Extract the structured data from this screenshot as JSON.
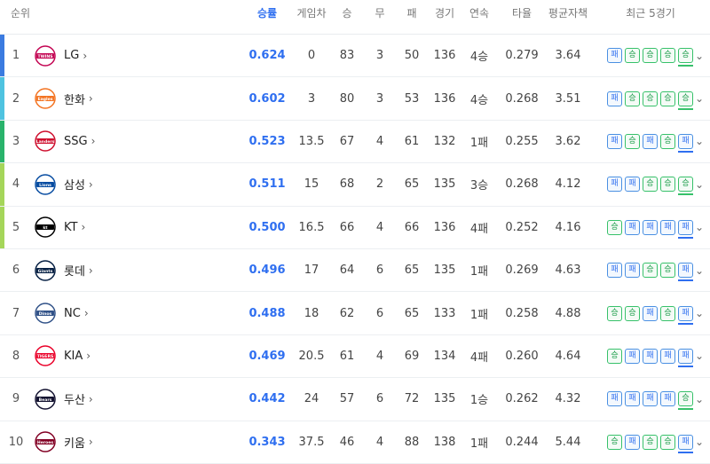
{
  "headers": {
    "rank": "순위",
    "wpct": "승률",
    "gb": "게임차",
    "w": "승",
    "d": "무",
    "l": "패",
    "g": "경기",
    "streak": "연속",
    "avg": "타율",
    "era": "평균자책",
    "recent": "최근 5경기"
  },
  "colors": {
    "accent": "#2f6ff0",
    "win": "#37c16a",
    "loss": "#4a90e2",
    "bar_top2": "#4a90e2",
    "bar_3": "#29b36b",
    "bar_4_5": "#a5d65a"
  },
  "rows": [
    {
      "rank": "1",
      "team": "LG",
      "wpct": "0.624",
      "gb": "0",
      "w": "83",
      "d": "3",
      "l": "50",
      "g": "136",
      "streak": "4승",
      "avg": "0.279",
      "era": "3.64",
      "recent": [
        "패",
        "승",
        "승",
        "승",
        "승"
      ],
      "bar": "#3b7be0",
      "logo_text": "TWINS",
      "logo_color": "#c30452"
    },
    {
      "rank": "2",
      "team": "한화",
      "wpct": "0.602",
      "gb": "3",
      "w": "80",
      "d": "3",
      "l": "53",
      "g": "136",
      "streak": "4승",
      "avg": "0.268",
      "era": "3.51",
      "recent": [
        "패",
        "승",
        "승",
        "승",
        "승"
      ],
      "bar": "#4fc3e0",
      "logo_text": "Eagles",
      "logo_color": "#f37321"
    },
    {
      "rank": "3",
      "team": "SSG",
      "wpct": "0.523",
      "gb": "13.5",
      "w": "67",
      "d": "4",
      "l": "61",
      "g": "132",
      "streak": "1패",
      "avg": "0.255",
      "era": "3.62",
      "recent": [
        "패",
        "승",
        "패",
        "승",
        "패"
      ],
      "bar": "#29b36b",
      "logo_text": "Landers",
      "logo_color": "#ce0e2d"
    },
    {
      "rank": "4",
      "team": "삼성",
      "wpct": "0.511",
      "gb": "15",
      "w": "68",
      "d": "2",
      "l": "65",
      "g": "135",
      "streak": "3승",
      "avg": "0.268",
      "era": "4.12",
      "recent": [
        "패",
        "패",
        "승",
        "승",
        "승"
      ],
      "bar": "#a5d65a",
      "logo_text": "Lions",
      "logo_color": "#074ca1"
    },
    {
      "rank": "5",
      "team": "KT",
      "wpct": "0.500",
      "gb": "16.5",
      "w": "66",
      "d": "4",
      "l": "66",
      "g": "136",
      "streak": "4패",
      "avg": "0.252",
      "era": "4.16",
      "recent": [
        "승",
        "패",
        "패",
        "패",
        "패"
      ],
      "bar": "#a5d65a",
      "logo_text": "kt",
      "logo_color": "#000000"
    },
    {
      "rank": "6",
      "team": "롯데",
      "wpct": "0.496",
      "gb": "17",
      "w": "64",
      "d": "6",
      "l": "65",
      "g": "135",
      "streak": "1패",
      "avg": "0.269",
      "era": "4.63",
      "recent": [
        "패",
        "패",
        "승",
        "승",
        "패"
      ],
      "bar": "",
      "logo_text": "Giants",
      "logo_color": "#041e42"
    },
    {
      "rank": "7",
      "team": "NC",
      "wpct": "0.488",
      "gb": "18",
      "w": "62",
      "d": "6",
      "l": "65",
      "g": "133",
      "streak": "1패",
      "avg": "0.258",
      "era": "4.88",
      "recent": [
        "승",
        "승",
        "패",
        "승",
        "패"
      ],
      "bar": "",
      "logo_text": "Dinos",
      "logo_color": "#315288"
    },
    {
      "rank": "8",
      "team": "KIA",
      "wpct": "0.469",
      "gb": "20.5",
      "w": "61",
      "d": "4",
      "l": "69",
      "g": "134",
      "streak": "4패",
      "avg": "0.260",
      "era": "4.64",
      "recent": [
        "승",
        "패",
        "패",
        "패",
        "패"
      ],
      "bar": "",
      "logo_text": "TIGERS",
      "logo_color": "#ea0029"
    },
    {
      "rank": "9",
      "team": "두산",
      "wpct": "0.442",
      "gb": "24",
      "w": "57",
      "d": "6",
      "l": "72",
      "g": "135",
      "streak": "1승",
      "avg": "0.262",
      "era": "4.32",
      "recent": [
        "패",
        "패",
        "패",
        "패",
        "승"
      ],
      "bar": "",
      "logo_text": "Bears",
      "logo_color": "#131230"
    },
    {
      "rank": "10",
      "team": "키움",
      "wpct": "0.343",
      "gb": "37.5",
      "w": "46",
      "d": "4",
      "l": "88",
      "g": "138",
      "streak": "1패",
      "avg": "0.244",
      "era": "5.44",
      "recent": [
        "승",
        "패",
        "승",
        "승",
        "패"
      ],
      "bar": "",
      "logo_text": "Heroes",
      "logo_color": "#820024"
    }
  ]
}
